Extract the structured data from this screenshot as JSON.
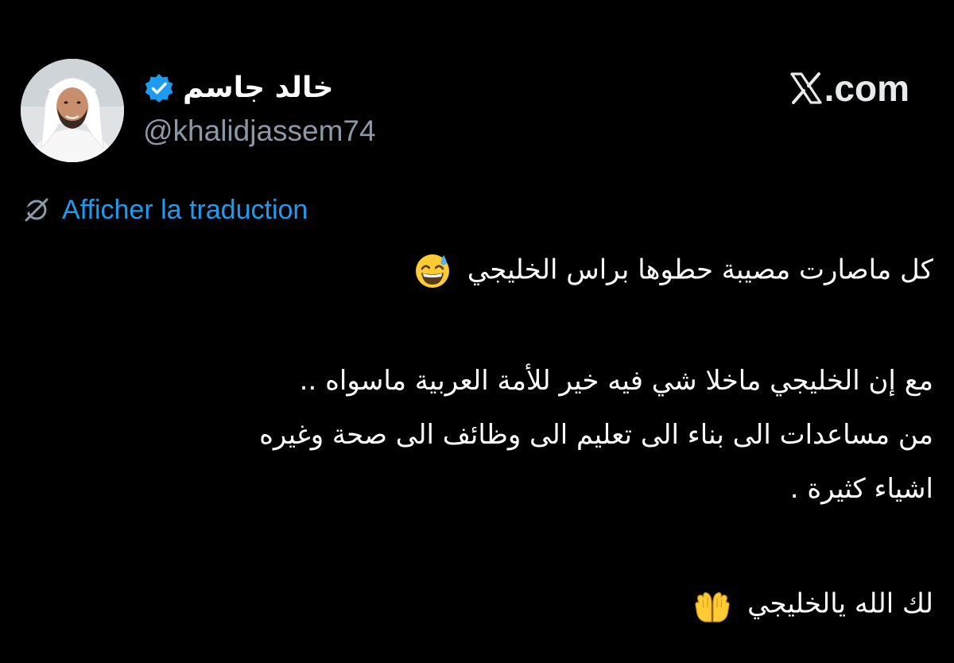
{
  "header": {
    "display_name": "خالد جاسم",
    "handle": "@khalidjassem74",
    "brand_text": ".com",
    "avatar_alt": "profile photo"
  },
  "translation": {
    "label": "Afficher la traduction",
    "icon": "translate-icon"
  },
  "tweet": {
    "lines": [
      "كل ماصارت مصيبة حطوها براس الخليجي",
      "مع إن الخليجي ماخلا شي فيه خير للأمة العربية ماسواه ..",
      "من مساعدات الى بناء الى تعليم الى وظائف الى صحة وغيره",
      "اشياء كثيرة .",
      "لك الله يالخليجي"
    ],
    "emojis": [
      "grinning-sweat-emoji",
      "raised-hands-emoji"
    ]
  },
  "colors": {
    "background": "#000000",
    "text": "#ffffff",
    "muted": "#8b98a5",
    "link": "#1d9bf0",
    "verified": "#1d9bf0"
  }
}
